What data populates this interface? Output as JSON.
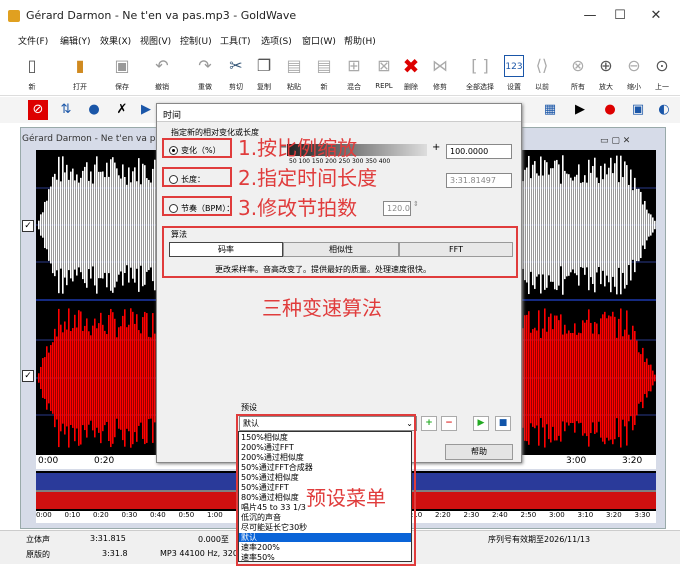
{
  "window": {
    "title": "Gérard Darmon - Ne t'en va pas.mp3 - GoldWave",
    "min": "—",
    "max": "☐",
    "close": "✕"
  },
  "menu": [
    "文件(F)",
    "编辑(Y)",
    "效果(X)",
    "视图(V)",
    "控制(U)",
    "工具(T)",
    "选项(S)",
    "窗口(W)",
    "帮助(H)"
  ],
  "toolbar": [
    {
      "label": "新",
      "icon": "new-file-icon"
    },
    {
      "label": "打开",
      "icon": "open-folder-icon"
    },
    {
      "label": "保存",
      "icon": "save-icon"
    },
    {
      "label": "撤销",
      "icon": "undo-icon"
    },
    {
      "label": "重做",
      "icon": "redo-icon"
    },
    {
      "label": "剪切",
      "icon": "cut-icon"
    },
    {
      "label": "复制",
      "icon": "copy-icon"
    },
    {
      "label": "粘贴",
      "icon": "paste-icon"
    },
    {
      "label": "新",
      "icon": "paste-new-icon"
    },
    {
      "label": "混合",
      "icon": "mix-icon"
    },
    {
      "label": "REPL",
      "icon": "replace-icon"
    },
    {
      "label": "删除",
      "icon": "delete-icon"
    },
    {
      "label": "修剪",
      "icon": "trim-icon"
    },
    {
      "label": "全部选择",
      "icon": "select-all-icon"
    },
    {
      "label": "设置",
      "icon": "set-icon"
    },
    {
      "label": "以前",
      "icon": "previous-icon"
    },
    {
      "label": "所有",
      "icon": "zoom-all-icon"
    },
    {
      "label": "放大",
      "icon": "zoom-in-icon"
    },
    {
      "label": "缩小",
      "icon": "zoom-out-icon"
    },
    {
      "label": "上一",
      "icon": "zoom-prev-icon"
    }
  ],
  "wave": {
    "header": "Gérard Darmon - Ne t'en va pas.mp3",
    "timeline": [
      "0:00",
      "0:20",
      "3:00",
      "3:20"
    ],
    "timeline2": [
      "0:00",
      "0:10",
      "0:20",
      "0:30",
      "0:40",
      "0:50",
      "1:00",
      "1:10",
      "1:20",
      "1:30",
      "1:40",
      "1:50",
      "2:00",
      "2:10",
      "2:20",
      "2:30",
      "2:40",
      "2:50",
      "3:00",
      "3:10",
      "3:20",
      "3:30"
    ]
  },
  "status": {
    "row1": [
      "立体声",
      "3:31.815",
      "0.000至",
      "序列号有效期至2026/11/13"
    ],
    "row2": [
      "原版的",
      "3:31.8",
      "MP3 44100 Hz, 320 k"
    ]
  },
  "dialog": {
    "title": "时间",
    "group": "指定新的相对变化或长度",
    "opt1": "变化（%）",
    "opt2": "长度：",
    "opt3": "节奏（BPM）：",
    "scale": "50  100  150  200  250  300  350  400",
    "value1": "100.0000",
    "value2": "3:31.81497",
    "value3": "120.0",
    "alg_group": "算法",
    "alg_buttons": [
      "码率",
      "相似性",
      "FFT"
    ],
    "alg_desc": "更改采样率。音高改变了。提供最好的质量。处理速度很快。",
    "preset_label": "预设",
    "preset_value": "默认",
    "help": "帮助",
    "presets": [
      "150%相似度",
      "200%通过FFT",
      "200%通过相似度",
      "50%通过FFT合成器",
      "50%通过相似度",
      "50%通过FFT",
      "80%通过相似度",
      "唱片45 to 33 1/3",
      "低沉的声音",
      "尽可能延长它30秒",
      "默认",
      "速率200%",
      "速率50%"
    ]
  },
  "annotations": {
    "a1": "1.按比例缩放",
    "a2": "2.指定时间长度",
    "a3": "3.修改节拍数",
    "a4": "三种变速算法",
    "a5": "预设菜单"
  },
  "colors": {
    "accent": "#e03c3c",
    "wave_top": "#ffffff",
    "wave_bottom": "#ff0000",
    "wave_bg": "#000000",
    "selection": "#0a64d8"
  }
}
